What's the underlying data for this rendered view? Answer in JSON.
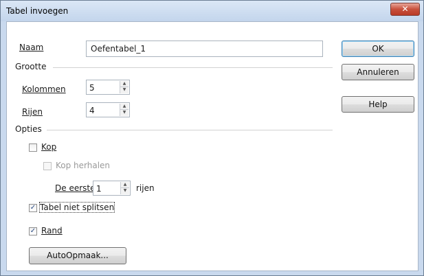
{
  "window": {
    "title": "Tabel invoegen",
    "close_glyph": "✕"
  },
  "name": {
    "label": "Naam",
    "value": "Oefentabel_1"
  },
  "size_section": {
    "title": "Grootte",
    "columns": {
      "label": "Kolommen",
      "value": "5"
    },
    "rows": {
      "label": "Rijen",
      "value": "4"
    }
  },
  "options_section": {
    "title": "Opties",
    "heading": {
      "label": "Kop",
      "checked": false
    },
    "repeat_heading": {
      "label": "Kop herhalen",
      "checked": false,
      "enabled": false
    },
    "first": {
      "label": "De eerste",
      "value": "1",
      "suffix": "rijen"
    },
    "dont_split": {
      "label": "Tabel niet splitsen",
      "checked": true
    },
    "border": {
      "label": "Rand",
      "checked": true
    },
    "autoformat_label": "AutoOpmaak..."
  },
  "buttons": {
    "ok": "OK",
    "cancel": "Annuleren",
    "help": "Help"
  },
  "check_glyph": "✓",
  "spin_up": "▲",
  "spin_down": "▼"
}
